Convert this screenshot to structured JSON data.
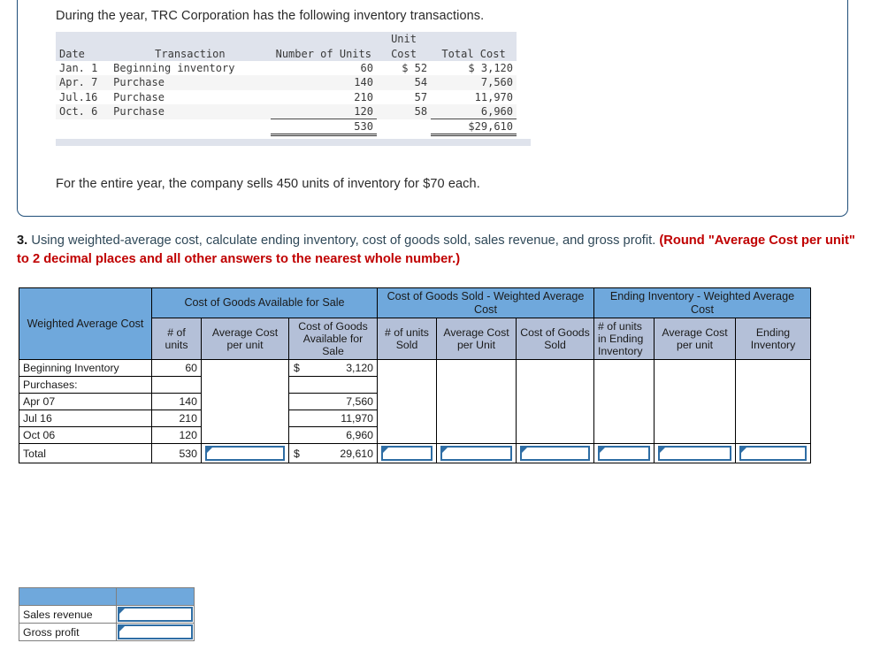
{
  "problem": {
    "intro": "During  the year, TRC Corporation has the following inventory transactions.",
    "closing": "For the entire year, the company sells 450 units of inventory for $70 each.",
    "inventory_table": {
      "header_top": "Unit",
      "columns": [
        "Date",
        "Transaction",
        "Number of Units",
        "Cost",
        "Total Cost"
      ],
      "rows": [
        {
          "date": "Jan. 1",
          "transaction": "Beginning inventory",
          "units": "60",
          "unit_cost": "$ 52",
          "total_cost": "$ 3,120"
        },
        {
          "date": "Apr. 7",
          "transaction": "Purchase",
          "units": "140",
          "unit_cost": "54",
          "total_cost": "7,560"
        },
        {
          "date": "Jul.16",
          "transaction": "Purchase",
          "units": "210",
          "unit_cost": "57",
          "total_cost": "11,970"
        },
        {
          "date": "Oct. 6",
          "transaction": "Purchase",
          "units": "120",
          "unit_cost": "58",
          "total_cost": "6,960"
        }
      ],
      "totals": {
        "date": "",
        "transaction": "",
        "units": "530",
        "unit_cost": "",
        "total_cost": "$29,610"
      }
    }
  },
  "question": {
    "number": "3.",
    "body": " Using weighted-average cost, calculate ending inventory, cost of goods sold, sales revenue, and gross profit. ",
    "emphasis": "(Round \"Average Cost per unit\" to 2 decimal places and all other answers to the nearest whole number.)"
  },
  "wavg": {
    "corner_label": "Weighted Average Cost",
    "groups": {
      "cgas": "Cost of Goods Available for Sale",
      "cogs": "Cost of Goods Sold - Weighted Average Cost",
      "ending": "Ending Inventory - Weighted Average Cost"
    },
    "subheaders": {
      "units": "# of units",
      "avg_cost_per_unit": "Average Cost per unit",
      "cgas": "Cost of Goods Available for Sale",
      "units_sold": "# of units Sold",
      "avg_cost_per_unit_sold": "Average Cost per Unit",
      "cost_of_goods_sold": "Cost of Goods Sold",
      "units_ending": "# of units in Ending Inventory",
      "avg_cost_per_unit_ending": "Average Cost per unit",
      "ending_inventory": "Ending Inventory"
    },
    "rows": [
      {
        "label": "Beginning Inventory",
        "indent": false,
        "units": "60",
        "dollar": "$",
        "cgas": "3,120"
      },
      {
        "label": "Purchases:",
        "indent": false,
        "units": "",
        "dollar": "",
        "cgas": ""
      },
      {
        "label": "Apr 07",
        "indent": true,
        "units": "140",
        "dollar": "",
        "cgas": "7,560"
      },
      {
        "label": "Jul 16",
        "indent": true,
        "units": "210",
        "dollar": "",
        "cgas": "11,970"
      },
      {
        "label": "Oct 06",
        "indent": true,
        "units": "120",
        "dollar": "",
        "cgas": "6,960"
      }
    ],
    "total_row": {
      "label": "Total",
      "units": "530",
      "dollar": "$",
      "cgas": "29,610"
    }
  },
  "summary": {
    "rows": [
      {
        "label": "Sales revenue",
        "value": ""
      },
      {
        "label": "Gross profit",
        "value": ""
      }
    ]
  },
  "colors": {
    "header_blue": "#6fa8dc",
    "subheader_blue": "#b4c0d8",
    "card_border": "#1f4e79",
    "emphasis_red": "#c00000",
    "input_border": "#2e6da4",
    "mono_header_bg": "#dfe3ec"
  }
}
